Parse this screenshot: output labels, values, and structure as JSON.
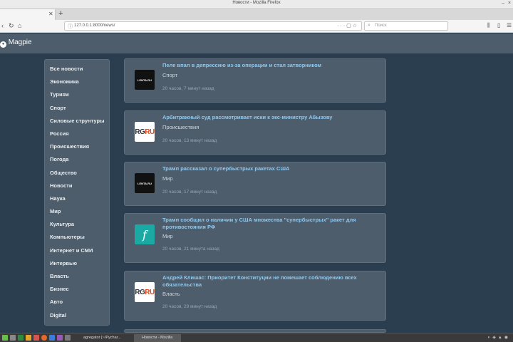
{
  "window": {
    "title": "Новости - Mozilla Firefox"
  },
  "tabs": [
    {
      "label": ""
    }
  ],
  "urlbar": {
    "url": "127.0.0.1:8000/news/",
    "search_placeholder": "Поиск"
  },
  "site": {
    "brand": "Magpie"
  },
  "sidebar": {
    "items": [
      {
        "label": "Все новости"
      },
      {
        "label": "Экономика"
      },
      {
        "label": "Туризм"
      },
      {
        "label": "Спорт"
      },
      {
        "label": "Силовые струнтуры"
      },
      {
        "label": "Россия"
      },
      {
        "label": "Происшествия"
      },
      {
        "label": "Погода"
      },
      {
        "label": "Общество"
      },
      {
        "label": "Новости"
      },
      {
        "label": "Наука"
      },
      {
        "label": "Мир"
      },
      {
        "label": "Культура"
      },
      {
        "label": "Компьютеры"
      },
      {
        "label": "Интернет и СМИ"
      },
      {
        "label": "Интервью"
      },
      {
        "label": "Власть"
      },
      {
        "label": "Бизнес"
      },
      {
        "label": "Авто"
      },
      {
        "label": "Digital"
      }
    ]
  },
  "news": [
    {
      "title": "Пеле впал в депрессию из-за операции и стал затворником",
      "category": "Спорт",
      "time": "20 часов, 7 минут назад",
      "source": "LENTA.RU",
      "source_icon": "lenta-logo"
    },
    {
      "title": "Арбитражный суд рассмотривает иски к экс-министру Абызову",
      "category": "Происшествия",
      "time": "20 часов, 13 минут назад",
      "source": "RGRU",
      "source_icon": "rg-logo"
    },
    {
      "title": "Трамп рассказал о супербыстрых ракетах США",
      "category": "Мир",
      "time": "20 часов, 17 минут назад",
      "source": "LENTA.RU",
      "source_icon": "lenta-logo"
    },
    {
      "title": "Трамп сообщил о наличии у США множества \"супербыстрых\" ракет для противостояния РФ",
      "category": "Мир",
      "time": "20 часов, 21 минута назад",
      "source": "f",
      "source_icon": "fn-logo"
    },
    {
      "title": "Андрей Клишас: Приоритет Конституции не помешает соблюдению всех обязательства",
      "category": "Власть",
      "time": "20 часов, 29 минут назад",
      "source": "RGRU",
      "source_icon": "rg-logo"
    }
  ],
  "taskbar": {
    "tasks": [
      {
        "label": "agregator [~/Pychar...",
        "active": false
      },
      {
        "label": "Новости - Mozilla Fir...",
        "active": true
      }
    ]
  }
}
